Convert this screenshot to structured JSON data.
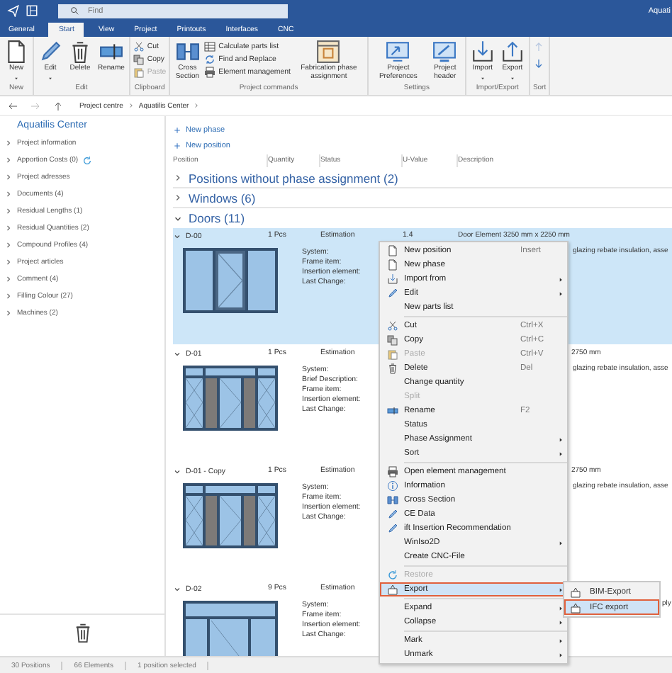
{
  "title_bar": {
    "search": {
      "placeholder": "Find"
    },
    "app_title": "Aquati"
  },
  "tabs": [
    {
      "label": "General",
      "selected": false
    },
    {
      "label": "Start",
      "selected": true
    },
    {
      "label": "View",
      "selected": false
    },
    {
      "label": "Project",
      "selected": false
    },
    {
      "label": "Printouts",
      "selected": false
    },
    {
      "label": "Interfaces",
      "selected": false
    },
    {
      "label": "CNC",
      "selected": false
    }
  ],
  "ribbon": [
    {
      "label": "New",
      "kind": "buttons",
      "buttons": [
        {
          "label": "New",
          "kind": "large",
          "dropdown": true,
          "disabled": false
        }
      ]
    },
    {
      "label": "Edit",
      "kind": "buttons",
      "buttons": [
        {
          "label": "Edit",
          "kind": "large",
          "dropdown": true,
          "disabled": false
        },
        {
          "label": "Delete",
          "kind": "large",
          "dropdown": false,
          "disabled": false
        },
        {
          "label": "Rename",
          "kind": "large",
          "dropdown": false,
          "disabled": false
        }
      ]
    },
    {
      "label": "Clipboard",
      "kind": "buttons",
      "buttons": [
        {
          "label": "Cut",
          "kind": "small",
          "dropdown": false,
          "disabled": false
        },
        {
          "label": "Copy",
          "kind": "small",
          "dropdown": false,
          "disabled": false
        },
        {
          "label": "Paste",
          "kind": "small",
          "dropdown": false,
          "disabled": true
        }
      ]
    },
    {
      "label": "Project commands",
      "kind": "buttons",
      "buttons": [
        {
          "label": "Cross Section",
          "kind": "large",
          "dropdown": false,
          "disabled": false
        },
        {
          "label": "Calculate parts list",
          "kind": "small",
          "dropdown": false,
          "disabled": false
        },
        {
          "label": "Find and Replace",
          "kind": "small",
          "dropdown": false,
          "disabled": false
        },
        {
          "label": "Element management",
          "kind": "small",
          "dropdown": false,
          "disabled": false
        },
        {
          "label": "Fabrication phase assignment",
          "kind": "large",
          "dropdown": false,
          "disabled": false
        }
      ]
    },
    {
      "label": "Settings",
      "kind": "buttons",
      "buttons": [
        {
          "label": "Project Preferences",
          "kind": "large",
          "dropdown": false,
          "disabled": false
        },
        {
          "label": "Project header",
          "kind": "large",
          "dropdown": false,
          "disabled": false
        }
      ]
    },
    {
      "label": "Import/Export",
      "kind": "buttons",
      "buttons": [
        {
          "label": "Import",
          "kind": "large",
          "dropdown": true,
          "disabled": false
        },
        {
          "label": "Export",
          "kind": "large",
          "dropdown": true,
          "disabled": false
        }
      ]
    },
    {
      "label": "Sort",
      "kind": "arrows"
    }
  ],
  "breadcrumb": [
    "Project centre",
    "Aquatilis Center"
  ],
  "sidebar": {
    "title": "Aquatilis Center",
    "items": [
      {
        "label": "Project information",
        "expanded": false
      },
      {
        "label": "Apportion Costs (0)",
        "expanded": false
      },
      {
        "label": "Project adresses",
        "expanded": false
      },
      {
        "label": "Documents (4)",
        "expanded": false
      },
      {
        "label": "Residual Lengths (1)",
        "expanded": false
      },
      {
        "label": "Residual Quantities (2)",
        "expanded": false
      },
      {
        "label": "Compound Profiles (4)",
        "expanded": false
      },
      {
        "label": "Project articles",
        "expanded": false
      },
      {
        "label": "Comment (4)",
        "expanded": false
      },
      {
        "label": "Filling Colour (27)",
        "expanded": false
      },
      {
        "label": "Machines (2)",
        "expanded": false
      }
    ]
  },
  "actions": [
    "New phase",
    "New position"
  ],
  "columns": [
    "Position",
    "Quantity",
    "Status",
    "U-Value",
    "Description"
  ],
  "groups": [
    {
      "label": "Positions without phase assignment (2)",
      "expanded": false
    },
    {
      "label": "Windows (6)",
      "expanded": false
    },
    {
      "label": "Doors (11)",
      "expanded": true,
      "rows": [
        {
          "position": "D-00",
          "quantity": "1 Pcs",
          "status": "Estimation",
          "u_value": "1.4",
          "description": {
            "line_1": "Door Element 3250 mm x 2250 mm",
            "line_2": "glazing rebate insulation, asse"
          },
          "fields": [
            "System:",
            "Frame item:",
            "Insertion element:",
            "Last Change:"
          ],
          "kind": "three-panel",
          "expanded": true,
          "selected": true
        },
        {
          "position": "D-01",
          "quantity": "1 Pcs",
          "status": "Estimation",
          "description": {
            "line_1": "2750 mm",
            "line_2": "glazing rebate insulation, asse"
          },
          "fields": [
            "System:",
            "Brief Description:",
            "Frame item:",
            "Insertion element:",
            "Last Change:"
          ],
          "kind": "transom-hatched",
          "expanded": true,
          "selected": false
        },
        {
          "position": "D-01 - Copy",
          "quantity": "1 Pcs",
          "status": "Estimation",
          "description": {
            "line_1": "2750 mm",
            "line_2": "glazing rebate insulation, asse"
          },
          "fields": [
            "System:",
            "Frame item:",
            "Insertion element:",
            "Last Change:"
          ],
          "kind": "transom-hatched",
          "expanded": true,
          "selected": false
        },
        {
          "position": "D-02",
          "quantity": "9 Pcs",
          "status": "Estimation",
          "description": {
            "line_2": "ply"
          },
          "fields": [
            "System:",
            "Frame item:",
            "Insertion element:",
            "Last Change:"
          ],
          "kind": "transom",
          "expanded": true,
          "selected": false
        }
      ]
    }
  ],
  "status_bar": [
    "30 Positions",
    "66 Elements",
    "1 position selected"
  ],
  "context_menu": {
    "items": [
      {
        "kind": "item",
        "label": "New position",
        "shortcut": "Insert",
        "submenu": false,
        "disabled": false,
        "highlighted": false
      },
      {
        "kind": "item",
        "label": "New phase",
        "submenu": false,
        "disabled": false,
        "highlighted": false
      },
      {
        "kind": "item",
        "label": "Import from",
        "submenu": true,
        "disabled": false,
        "highlighted": false
      },
      {
        "kind": "item",
        "label": "Edit",
        "submenu": true,
        "disabled": false,
        "highlighted": false
      },
      {
        "kind": "item",
        "label": "New parts list",
        "submenu": false,
        "disabled": false,
        "highlighted": false
      },
      {
        "kind": "separator"
      },
      {
        "kind": "item",
        "label": "Cut",
        "shortcut": "Ctrl+X",
        "submenu": false,
        "disabled": false,
        "highlighted": false
      },
      {
        "kind": "item",
        "label": "Copy",
        "shortcut": "Ctrl+C",
        "submenu": false,
        "disabled": false,
        "highlighted": false
      },
      {
        "kind": "item",
        "label": "Paste",
        "shortcut": "Ctrl+V",
        "submenu": false,
        "disabled": true,
        "highlighted": false
      },
      {
        "kind": "item",
        "label": "Delete",
        "shortcut": "Del",
        "submenu": false,
        "disabled": false,
        "highlighted": false
      },
      {
        "kind": "item",
        "label": "Change quantity",
        "submenu": false,
        "disabled": false,
        "highlighted": false
      },
      {
        "kind": "item",
        "label": "Split",
        "submenu": false,
        "disabled": true,
        "highlighted": false
      },
      {
        "kind": "item",
        "label": "Rename",
        "shortcut": "F2",
        "submenu": false,
        "disabled": false,
        "highlighted": false
      },
      {
        "kind": "item",
        "label": "Status",
        "submenu": false,
        "disabled": false,
        "highlighted": false
      },
      {
        "kind": "item",
        "label": "Phase Assignment",
        "submenu": true,
        "disabled": false,
        "highlighted": false
      },
      {
        "kind": "item",
        "label": "Sort",
        "submenu": true,
        "disabled": false,
        "highlighted": false
      },
      {
        "kind": "separator"
      },
      {
        "kind": "item",
        "label": "Open element management",
        "submenu": false,
        "disabled": false,
        "highlighted": false
      },
      {
        "kind": "item",
        "label": "Information",
        "submenu": false,
        "disabled": false,
        "highlighted": false
      },
      {
        "kind": "item",
        "label": "Cross Section",
        "submenu": false,
        "disabled": false,
        "highlighted": false
      },
      {
        "kind": "item",
        "label": "CE Data",
        "submenu": false,
        "disabled": false,
        "highlighted": false
      },
      {
        "kind": "item",
        "label": "ift Insertion Recommendation",
        "submenu": false,
        "disabled": false,
        "highlighted": false
      },
      {
        "kind": "item",
        "label": "WinIso2D",
        "submenu": true,
        "disabled": false,
        "highlighted": false
      },
      {
        "kind": "item",
        "label": "Create CNC-File",
        "submenu": false,
        "disabled": false,
        "highlighted": false
      },
      {
        "kind": "separator"
      },
      {
        "kind": "item",
        "label": "Restore",
        "submenu": false,
        "disabled": true,
        "highlighted": false
      },
      {
        "kind": "item",
        "label": "Export",
        "submenu": true,
        "disabled": false,
        "highlighted": true
      },
      {
        "kind": "separator"
      },
      {
        "kind": "item",
        "label": "Expand",
        "submenu": true,
        "disabled": false,
        "highlighted": false
      },
      {
        "kind": "item",
        "label": "Collapse",
        "submenu": true,
        "disabled": false,
        "highlighted": false
      },
      {
        "kind": "separator"
      },
      {
        "kind": "item",
        "label": "Mark",
        "submenu": true,
        "disabled": false,
        "highlighted": false
      },
      {
        "kind": "item",
        "label": "Unmark",
        "submenu": true,
        "disabled": false,
        "highlighted": false
      }
    ],
    "submenu": [
      {
        "label": "BIM-Export",
        "highlighted": false
      },
      {
        "label": "IFC export",
        "highlighted": true
      }
    ]
  }
}
